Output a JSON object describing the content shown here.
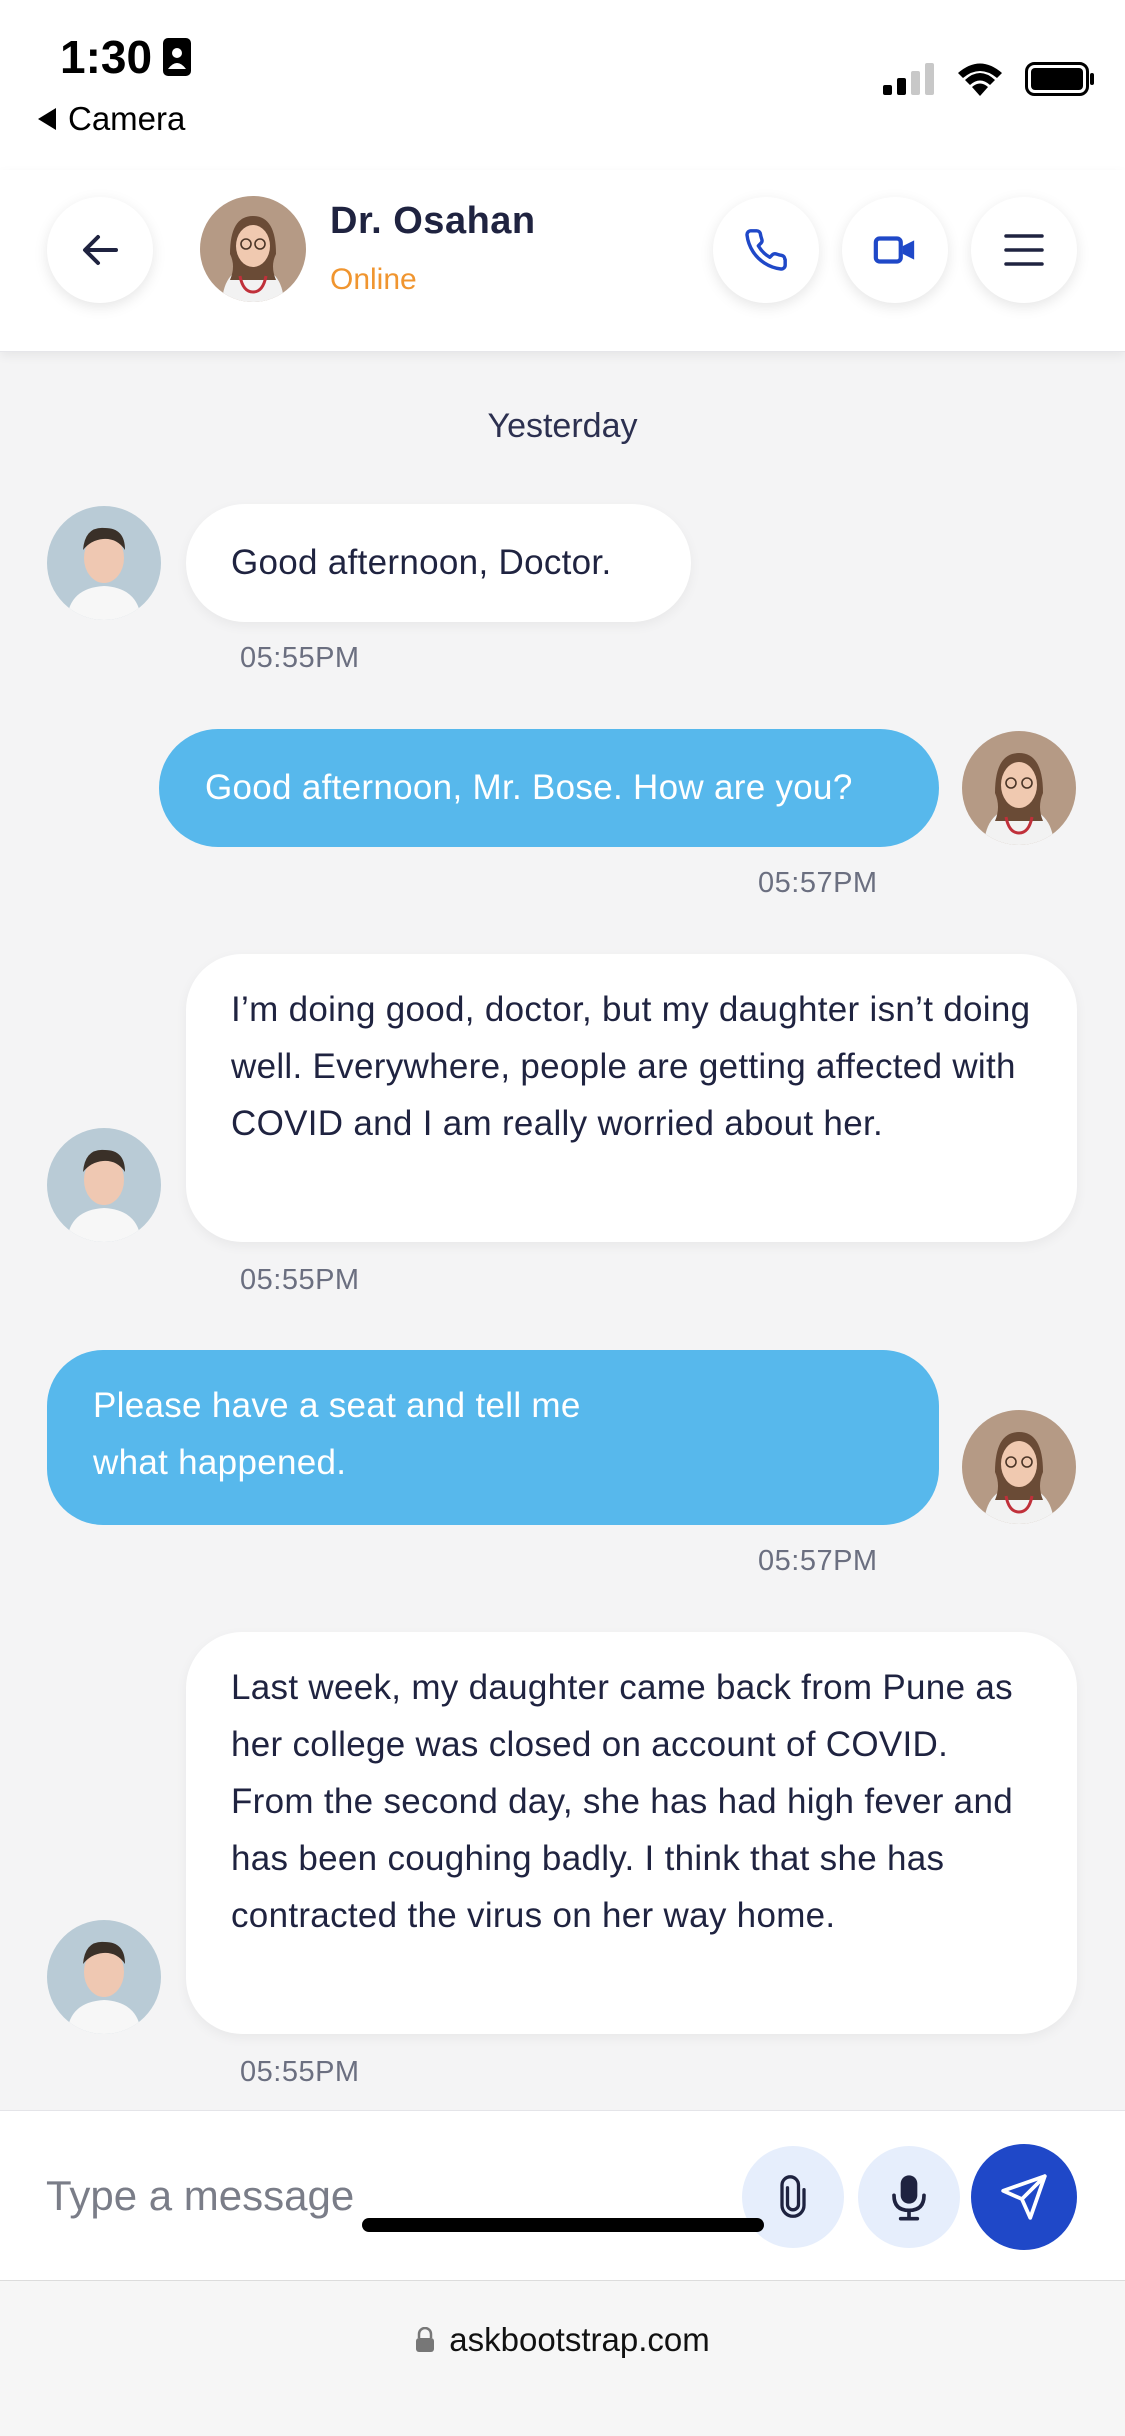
{
  "status_bar": {
    "time": "1:30",
    "back_app": "Camera",
    "icons": [
      "signal-icon",
      "wifi-icon",
      "battery-icon"
    ]
  },
  "header": {
    "name": "Dr. Osahan",
    "status": "Online",
    "status_color": "#f0952f",
    "accent_color": "#1f48c8"
  },
  "chat": {
    "date_separator": "Yesterday",
    "messages": [
      {
        "direction": "incoming",
        "text": "Good afternoon, Doctor.",
        "time": "05:55PM"
      },
      {
        "direction": "outgoing",
        "text": "Good afternoon, Mr. Bose. How are you?",
        "time": "05:57PM"
      },
      {
        "direction": "incoming",
        "text": "I’m doing good, doctor, but my daughter isn’t doing well. Everywhere, people are getting affected with COVID and I am really worried about her.",
        "time": "05:55PM"
      },
      {
        "direction": "outgoing",
        "text": "Please have a seat and tell me what happened.",
        "time": "05:57PM"
      },
      {
        "direction": "incoming",
        "text": "Last week, my daughter came back from Pune as her college was closed on account of COVID. From the second day, she has had high fever and has been coughing badly. I think that she has contracted the virus on her way home.",
        "time": "05:55PM"
      }
    ],
    "incoming_bubble_color": "#ffffff",
    "outgoing_bubble_color": "#57b8ec"
  },
  "composer": {
    "placeholder": "Type a message",
    "value": ""
  },
  "browser": {
    "url": "askbootstrap.com"
  }
}
